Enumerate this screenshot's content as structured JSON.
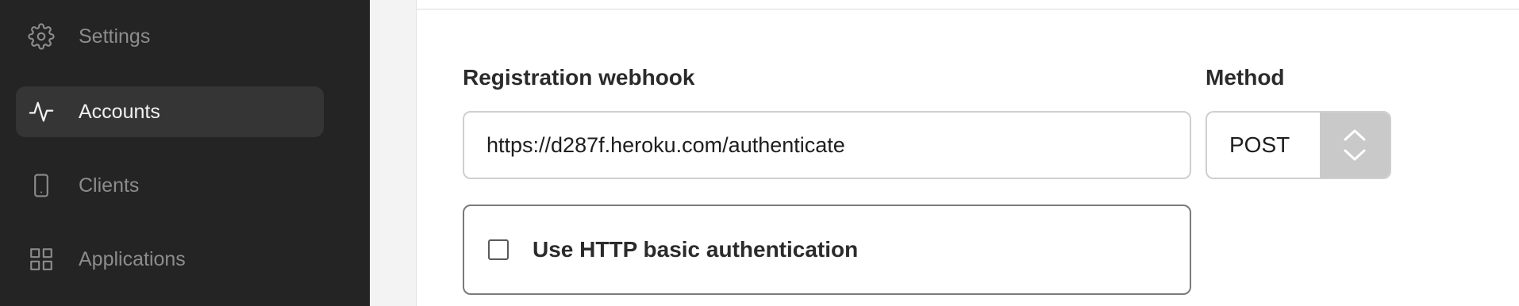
{
  "sidebar": {
    "items": [
      {
        "label": "Settings",
        "icon": "gear-icon",
        "active": false
      },
      {
        "label": "Accounts",
        "icon": "activity-icon",
        "active": true
      },
      {
        "label": "Clients",
        "icon": "phone-icon",
        "active": false
      },
      {
        "label": "Applications",
        "icon": "grid-icon",
        "active": false
      }
    ]
  },
  "form": {
    "webhook_label": "Registration webhook",
    "webhook_value": "https://d287f.heroku.com/authenticate",
    "method_label": "Method",
    "method_value": "POST",
    "basic_auth_label": "Use HTTP basic authentication"
  },
  "colors": {
    "sidebar_bg": "#242424",
    "sidebar_active": "#353535",
    "panel_bg": "#ffffff"
  }
}
